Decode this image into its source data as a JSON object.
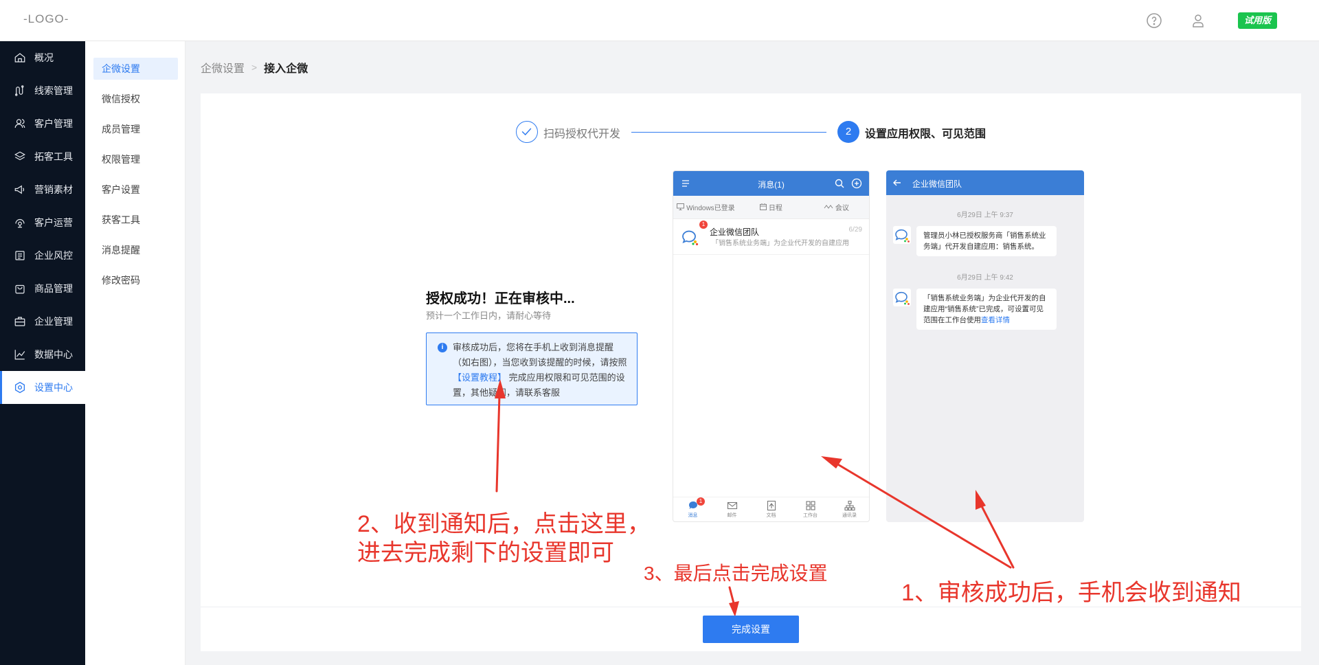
{
  "header": {
    "logo": "-LOGO-",
    "help_icon": "help-circle-icon",
    "user_icon": "user-icon",
    "trial_badge": "试用版"
  },
  "sidebar": {
    "items": [
      {
        "label": "概况",
        "icon": "home-icon"
      },
      {
        "label": "线索管理",
        "icon": "route-icon"
      },
      {
        "label": "客户管理",
        "icon": "users-icon"
      },
      {
        "label": "拓客工具",
        "icon": "tool-icon"
      },
      {
        "label": "营销素材",
        "icon": "megaphone-icon"
      },
      {
        "label": "客户运营",
        "icon": "operation-icon"
      },
      {
        "label": "企业风控",
        "icon": "risk-icon"
      },
      {
        "label": "商品管理",
        "icon": "bag-icon"
      },
      {
        "label": "企业管理",
        "icon": "briefcase-icon"
      },
      {
        "label": "数据中心",
        "icon": "chart-icon"
      },
      {
        "label": "设置中心",
        "icon": "settings-icon",
        "active": true
      }
    ]
  },
  "submenu": {
    "items": [
      "企微设置",
      "微信授权",
      "成员管理",
      "权限管理",
      "客户设置",
      "获客工具",
      "消息提醒",
      "修改密码"
    ],
    "active": "企微设置"
  },
  "breadcrumb": {
    "parent": "企微设置",
    "separator": ">",
    "current": "接入企微"
  },
  "steps": {
    "step1": "扫码授权代开发",
    "step2_number": "2",
    "step2": "设置应用权限、可见范围"
  },
  "status": {
    "title": "授权成功！正在审核中...",
    "subtitle": "预计一个工作日内，请耐心等待",
    "info_icon": "i",
    "info_text_1": "审核成功后，您将在手机上收到消息提醒（如右图），当您收到该提醒的时候，请按照",
    "info_link": "【设置教程】",
    "info_text_2": "完成应用权限和可见范围的设置，其他疑问，请联系客服"
  },
  "phone1": {
    "title": "消息(1)",
    "tabs": [
      "Windows已登录",
      "日程",
      "会议"
    ],
    "chat": {
      "name": "企业微信团队",
      "time": "6/29",
      "preview": "「销售系统业务端」为企业代开发的自建应用",
      "badge": "1"
    },
    "bottom_nav": [
      "消息",
      "邮件",
      "文档",
      "工作台",
      "通讯录"
    ],
    "bottom_badge": "1"
  },
  "phone2": {
    "title": "企业微信团队",
    "messages": [
      {
        "time": "6月29日  上午 9:37",
        "text": "管理员小林已授权服务商「销售系统业务端」代开发自建应用：销售系统。",
        "link": ""
      },
      {
        "time": "6月29日  上午 9:42",
        "text": "「销售系统业务端」为企业代开发的自建应用“销售系统”已完成，可设置可见范围在工作台使用",
        "link": "查看详情"
      }
    ]
  },
  "annotations": {
    "note1": "1、审核成功后，手机会收到通知",
    "note2_line1": "2、收到通知后，点击这里，",
    "note2_line2": "进去完成剩下的设置即可",
    "note3": "3、最后点击完成设置"
  },
  "finish_button": "完成设置",
  "colors": {
    "primary": "#2e7bf0",
    "sidebar_bg": "#0b1422",
    "annotation_red": "#e8362c",
    "trial_green": "#1bc44e"
  }
}
